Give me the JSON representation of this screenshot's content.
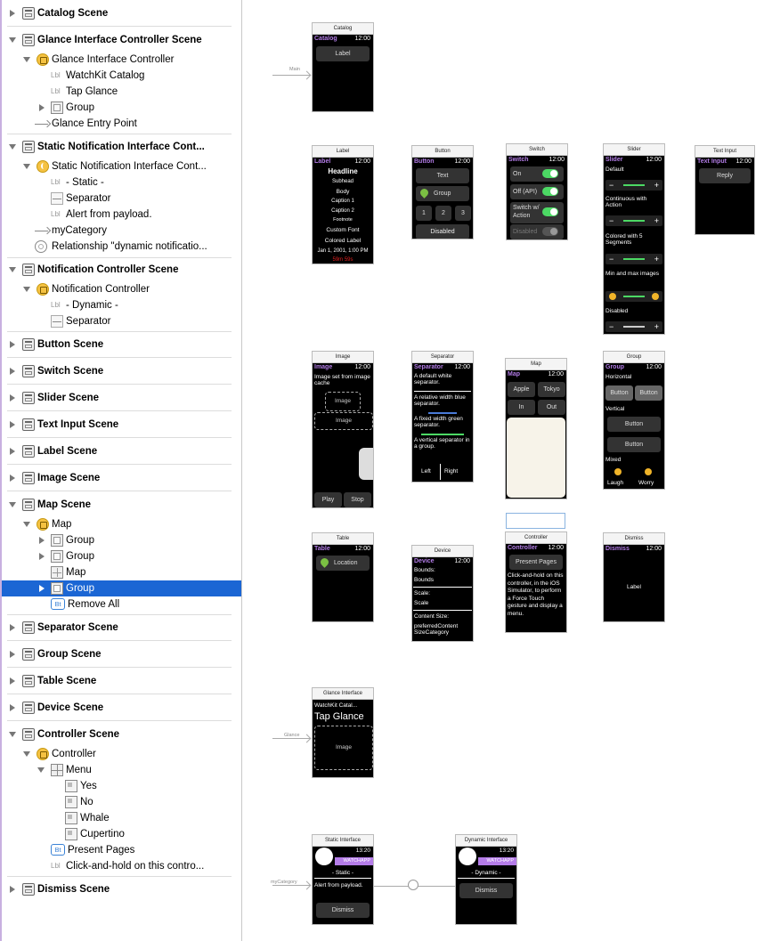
{
  "outline": {
    "rows": [
      {
        "label": "Catalog Scene"
      },
      {
        "label": "Glance Interface Controller Scene"
      },
      {
        "label": "Glance Interface Controller"
      },
      {
        "label": "WatchKit Catalog"
      },
      {
        "label": "Tap Glance"
      },
      {
        "label": "Group"
      },
      {
        "label": "Glance Entry Point"
      },
      {
        "label": "Static Notification Interface Cont..."
      },
      {
        "label": "Static Notification Interface Cont..."
      },
      {
        "label": "- Static -"
      },
      {
        "label": "Separator"
      },
      {
        "label": "Alert from payload."
      },
      {
        "label": "myCategory"
      },
      {
        "label": "Relationship \"dynamic notificatio..."
      },
      {
        "label": "Notification Controller Scene"
      },
      {
        "label": "Notification Controller"
      },
      {
        "label": "- Dynamic -"
      },
      {
        "label": "Separator"
      },
      {
        "label": "Button Scene"
      },
      {
        "label": "Switch Scene"
      },
      {
        "label": "Slider Scene"
      },
      {
        "label": "Text Input Scene"
      },
      {
        "label": "Label Scene"
      },
      {
        "label": "Image Scene"
      },
      {
        "label": "Map Scene"
      },
      {
        "label": "Map"
      },
      {
        "label": "Group"
      },
      {
        "label": "Group"
      },
      {
        "label": "Map"
      },
      {
        "label": "Group"
      },
      {
        "label": "Remove All"
      },
      {
        "label": "Separator Scene"
      },
      {
        "label": "Group Scene"
      },
      {
        "label": "Table Scene"
      },
      {
        "label": "Device Scene"
      },
      {
        "label": "Controller Scene"
      },
      {
        "label": "Controller"
      },
      {
        "label": "Menu"
      },
      {
        "label": "Yes"
      },
      {
        "label": "No"
      },
      {
        "label": "Whale"
      },
      {
        "label": "Cupertino"
      },
      {
        "label": "Present Pages"
      },
      {
        "label": "Click-and-hold on this contro..."
      },
      {
        "label": "Dismiss Scene"
      }
    ],
    "icon_labels": {
      "lbl": "Lbl",
      "bt": "Bt"
    }
  },
  "canvas": {
    "entry_labels": {
      "main": "Main",
      "glance": "Glance",
      "category": "myCategory"
    },
    "catalog": {
      "title": "Catalog",
      "name": "Catalog",
      "time": "12:00",
      "button": "Label"
    },
    "label": {
      "title": "Label",
      "name": "Label",
      "time": "12:00",
      "lines": [
        "Headline",
        "Subhead",
        "Body",
        "Caption 1",
        "Caption 2",
        "Footnote",
        "Custom Font",
        "Colored Label",
        "Jan 1, 2001, 1:00 PM",
        "59m 59s"
      ]
    },
    "button": {
      "title": "Button",
      "name": "Button",
      "time": "12:00",
      "text": "Text",
      "group": "Group",
      "n1": "1",
      "n2": "2",
      "n3": "3",
      "disabled": "Disabled"
    },
    "switch": {
      "title": "Switch",
      "name": "Switch",
      "time": "12:00",
      "on": "On",
      "off": "Off (API)",
      "action": "Switch w/ Action",
      "disabled": "Disabled"
    },
    "slider": {
      "title": "Slider",
      "name": "Slider",
      "time": "12:00",
      "default": "Default",
      "continuous": "Continuous with Action",
      "colored": "Colored with 5 Segments",
      "minmax": "Min and max images",
      "disabled": "Disabled",
      "minus": "−",
      "plus": "+"
    },
    "textinput": {
      "title": "Text Input",
      "name": "Text Input",
      "time": "12:00",
      "reply": "Reply"
    },
    "image": {
      "title": "Image",
      "name": "Image",
      "time": "12:00",
      "caption": "Image set from image cache",
      "img1": "Image",
      "img2": "Image",
      "play": "Play",
      "stop": "Stop"
    },
    "separator": {
      "title": "Separator",
      "name": "Separator",
      "time": "12:00",
      "t1": "A default white separator.",
      "t2": "A relative width blue separator.",
      "t3": "A fixed width green separator.",
      "t4": "A vertical separator in a group.",
      "left": "Left",
      "right": "Right"
    },
    "map": {
      "title": "Map",
      "name": "Map",
      "time": "12:00",
      "apple": "Apple",
      "tokyo": "Tokyo",
      "in": "In",
      "out": "Out"
    },
    "group": {
      "title": "Group",
      "name": "Group",
      "time": "12:00",
      "horizontal": "Horizontal",
      "b1": "Button",
      "b2": "Button",
      "vertical": "Vertical",
      "b3": "Button",
      "b4": "Button",
      "mixed": "Mixed",
      "laugh": "Laugh",
      "worry": "Worry"
    },
    "table": {
      "title": "Table",
      "name": "Table",
      "time": "12:00",
      "row": "Location"
    },
    "device": {
      "title": "Device",
      "name": "Device",
      "time": "12:00",
      "bounds_l": "Bounds:",
      "bounds": "Bounds",
      "scale_l": "Scale:",
      "scale": "Scale",
      "content_l": "Content Size:",
      "content": "preferredContent SizeCategory"
    },
    "controller": {
      "title": "Controller",
      "name": "Controller",
      "time": "12:00",
      "present": "Present Pages",
      "body": "Click-and-hold on this controller, in the iOS Simulator, to perform a Force Touch gesture and display a menu."
    },
    "dismiss": {
      "title": "Dismiss",
      "name": "Dismiss",
      "time": "12:00",
      "label": "Label"
    },
    "glance": {
      "title": "Glance Interface",
      "app": "WatchKit Catal...",
      "tap": "Tap Glance",
      "image": "Image"
    },
    "static": {
      "title": "Static Interface",
      "time": "13:20",
      "app": "WATCHAPP",
      "tag": "- Static -",
      "alert": "Alert from payload.",
      "dismiss": "Dismiss"
    },
    "dynamic": {
      "title": "Dynamic Interface",
      "time": "13:20",
      "app": "WATCHAPP",
      "tag": "- Dynamic -",
      "dismiss": "Dismiss"
    }
  },
  "colors": {
    "selection": "#1b66d4",
    "accent": "#b27ce6",
    "switch_on": "#4cd964"
  }
}
